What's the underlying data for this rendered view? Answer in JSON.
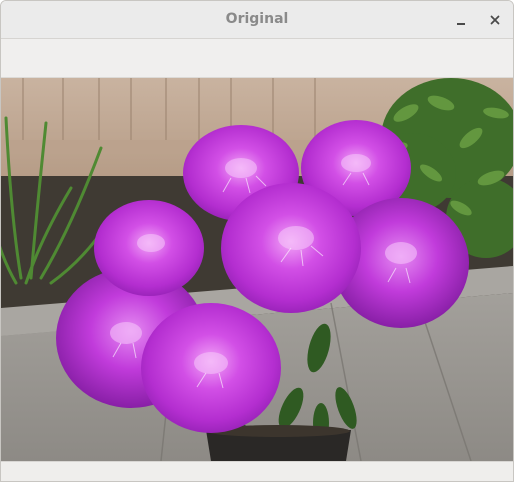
{
  "window": {
    "title": "Original",
    "minimize_icon": "minimize-icon",
    "close_icon": "close-icon"
  },
  "image": {
    "subject": "photo",
    "accent_colors": [
      "#b42ed0",
      "#d24fe6",
      "#4d7f2e",
      "#bfa58b"
    ]
  }
}
